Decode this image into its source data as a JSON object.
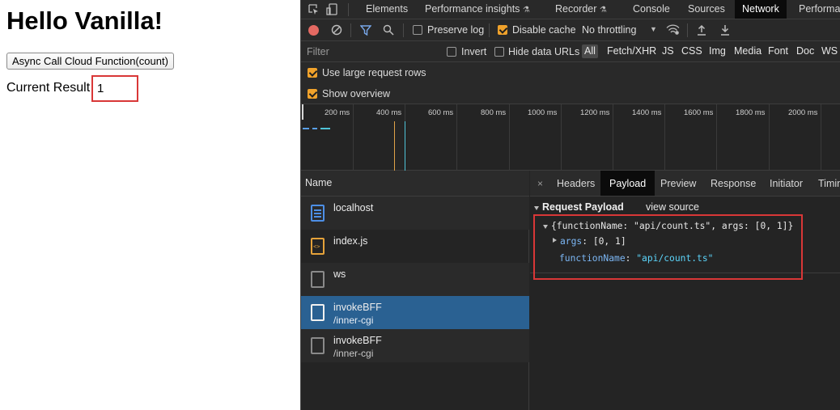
{
  "page": {
    "heading": "Hello Vanilla!",
    "button_label": "Async Call Cloud Function(count)",
    "result_label": "Current Result",
    "result_value": "1"
  },
  "devtools": {
    "tabs": [
      "Elements",
      "Performance insights",
      "Recorder",
      "Console",
      "Sources",
      "Network",
      "Performan"
    ],
    "active_tab": "Network",
    "toolbar": {
      "preserve_log": "Preserve log",
      "preserve_log_checked": false,
      "disable_cache": "Disable cache",
      "disable_cache_checked": true,
      "throttling": "No throttling"
    },
    "filter": {
      "placeholder": "Filter",
      "invert": "Invert",
      "hide_data_urls": "Hide data URLs",
      "types": [
        "All",
        "Fetch/XHR",
        "JS",
        "CSS",
        "Img",
        "Media",
        "Font",
        "Doc",
        "WS"
      ],
      "active_type": "All"
    },
    "options": {
      "large_rows": "Use large request rows",
      "show_overview": "Show overview"
    },
    "overview_ticks": [
      "200 ms",
      "400 ms",
      "600 ms",
      "800 ms",
      "1000 ms",
      "1200 ms",
      "1400 ms",
      "1600 ms",
      "1800 ms",
      "2000 ms"
    ],
    "list_header": "Name",
    "requests": [
      {
        "name": "localhost",
        "sub": "",
        "icon": "document-icon"
      },
      {
        "name": "index.js",
        "sub": "",
        "icon": "script-icon"
      },
      {
        "name": "ws",
        "sub": "",
        "icon": "file-icon"
      },
      {
        "name": "invokeBFF",
        "sub": "/inner-cgi",
        "icon": "file-icon",
        "selected": true
      },
      {
        "name": "invokeBFF",
        "sub": "/inner-cgi",
        "icon": "file-icon"
      }
    ],
    "detail": {
      "close": "×",
      "tabs": [
        "Headers",
        "Payload",
        "Preview",
        "Response",
        "Initiator",
        "Timin"
      ],
      "active_tab": "Payload",
      "payload_title": "Request Payload",
      "view_source": "view source",
      "json_summary": "{functionName: \"api/count.ts\", args: [0, 1]}",
      "args_key": "args",
      "args_value": "[0, 1]",
      "fn_key": "functionName",
      "fn_value": "\"api/count.ts\""
    }
  },
  "colors": {
    "highlight": "#d93737",
    "selected_row": "#2a6192",
    "checkbox_on": "#f0a22b"
  }
}
